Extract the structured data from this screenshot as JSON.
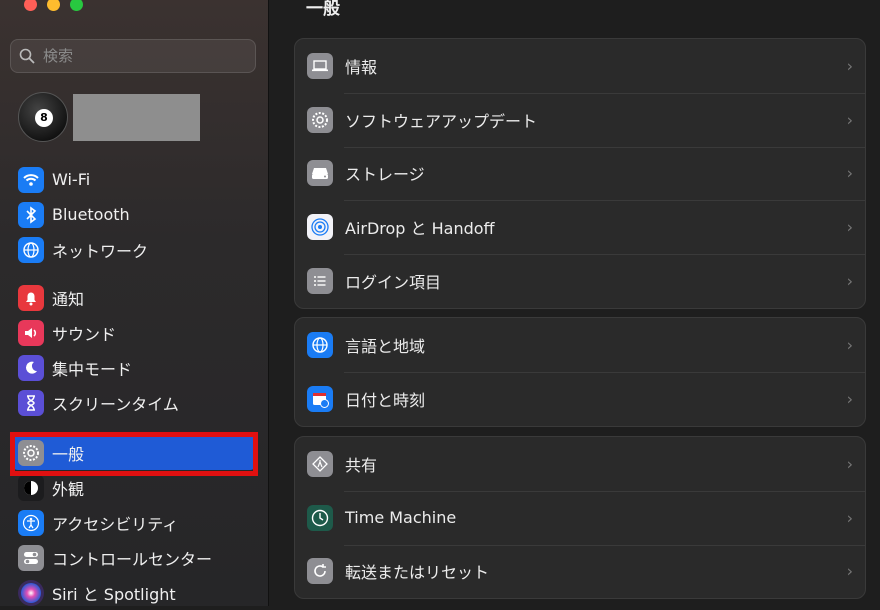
{
  "sidebar": {
    "search_placeholder": "検索",
    "groups": [
      [
        {
          "label": "Wi-Fi",
          "icon": "wifi-icon",
          "color": "#1a7cf5"
        },
        {
          "label": "Bluetooth",
          "icon": "bluetooth-icon",
          "color": "#1a7cf5"
        },
        {
          "label": "ネットワーク",
          "icon": "globe-icon",
          "color": "#1a7cf5"
        }
      ],
      [
        {
          "label": "通知",
          "icon": "bell-icon",
          "color": "#e8383d"
        },
        {
          "label": "サウンド",
          "icon": "speaker-icon",
          "color": "#e8385a"
        },
        {
          "label": "集中モード",
          "icon": "moon-icon",
          "color": "#5b4fd6"
        },
        {
          "label": "スクリーンタイム",
          "icon": "hourglass-icon",
          "color": "#5b4fd6"
        }
      ],
      [
        {
          "label": "一般",
          "icon": "gear-icon",
          "color": "#8e8e93",
          "selected": true
        },
        {
          "label": "外観",
          "icon": "appearance-icon",
          "color": "#1c1c1e"
        },
        {
          "label": "アクセシビリティ",
          "icon": "accessibility-icon",
          "color": "#1a7cf5"
        },
        {
          "label": "コントロールセンター",
          "icon": "toggles-icon",
          "color": "#8e8e93"
        },
        {
          "label": "Siri と Spotlight",
          "icon": "siri-icon",
          "color": "#3a2a5e"
        }
      ]
    ]
  },
  "main": {
    "title": "一般",
    "cards": [
      [
        {
          "label": "情報",
          "icon": "laptop-icon",
          "color": "#8e8e93"
        },
        {
          "label": "ソフトウェアアップデート",
          "icon": "gear-badge-icon",
          "color": "#8e8e93"
        },
        {
          "label": "ストレージ",
          "icon": "drive-icon",
          "color": "#8e8e93"
        },
        {
          "label": "AirDrop と Handoff",
          "icon": "airdrop-icon",
          "color": "#f2f2f7"
        },
        {
          "label": "ログイン項目",
          "icon": "list-icon",
          "color": "#8e8e93"
        }
      ],
      [
        {
          "label": "言語と地域",
          "icon": "globe-icon",
          "color": "#1a7cf5"
        },
        {
          "label": "日付と時刻",
          "icon": "calendar-clock-icon",
          "color": "#1a7cf5"
        }
      ],
      [
        {
          "label": "共有",
          "icon": "sharing-icon",
          "color": "#8e8e93"
        },
        {
          "label": "Time Machine",
          "icon": "time-machine-icon",
          "color": "#1e5a4a"
        },
        {
          "label": "転送またはリセット",
          "icon": "reset-icon",
          "color": "#8e8e93"
        }
      ]
    ]
  }
}
